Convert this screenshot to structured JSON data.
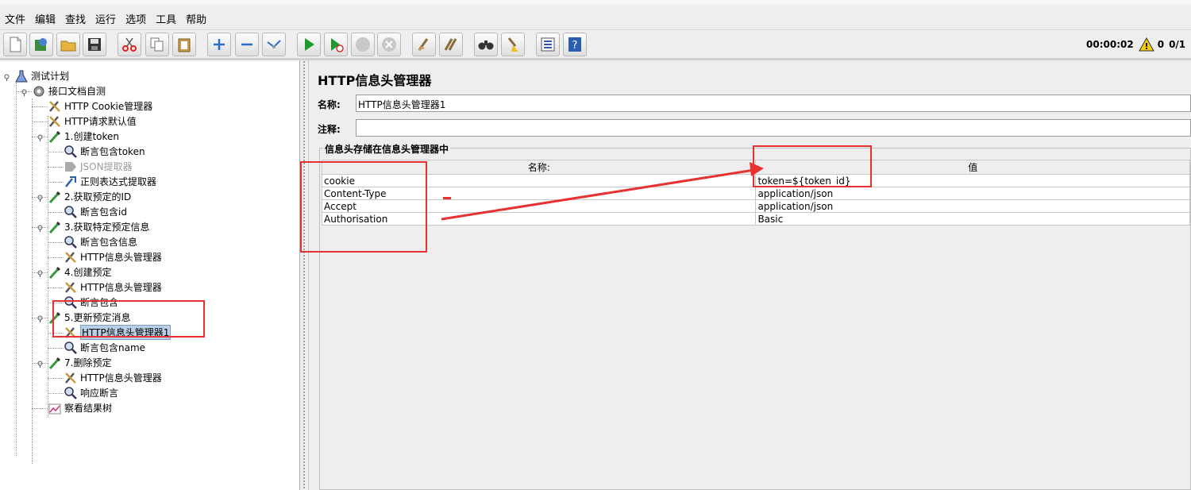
{
  "menu": [
    "文件",
    "编辑",
    "查找",
    "运行",
    "选项",
    "工具",
    "帮助"
  ],
  "toolbar_icons": [
    "new-icon",
    "templates-icon",
    "open-icon",
    "save-icon",
    "cut-icon",
    "copy-icon",
    "paste-icon",
    "expand-icon",
    "collapse-icon",
    "toggle-icon",
    "start-icon",
    "start-no-pause-icon",
    "stop-icon",
    "shutdown-icon",
    "clear-icon",
    "clear-all-icon",
    "search-icon",
    "reset-search-icon",
    "function-helper-icon",
    "help-icon"
  ],
  "status": {
    "timer": "00:00:02",
    "warnings": "0",
    "threads": "0/1"
  },
  "tree": [
    {
      "label": "测试计划",
      "icon": "flask-icon",
      "depth": 0
    },
    {
      "label": "接口文档自测",
      "icon": "gear-icon",
      "depth": 1
    },
    {
      "label": "HTTP Cookie管理器",
      "icon": "tools-icon",
      "depth": 2
    },
    {
      "label": "HTTP请求默认值",
      "icon": "tools-icon",
      "depth": 2
    },
    {
      "label": "1.创建token",
      "icon": "pipette-icon",
      "depth": 2
    },
    {
      "label": "断言包含token",
      "icon": "magnifier-icon",
      "depth": 3
    },
    {
      "label": "JSON提取器",
      "icon": "extractor-icon",
      "depth": 3
    },
    {
      "label": "正则表达式提取器",
      "icon": "regex-icon",
      "depth": 3
    },
    {
      "label": "2.获取预定的ID",
      "icon": "pipette-icon",
      "depth": 2
    },
    {
      "label": "断言包含id",
      "icon": "magnifier-icon",
      "depth": 3
    },
    {
      "label": "3.获取特定预定信息",
      "icon": "pipette-icon",
      "depth": 2
    },
    {
      "label": "断言包含信息",
      "icon": "magnifier-icon",
      "depth": 3
    },
    {
      "label": "HTTP信息头管理器",
      "icon": "tools-icon",
      "depth": 3
    },
    {
      "label": "4.创建预定",
      "icon": "pipette-icon",
      "depth": 2
    },
    {
      "label": "HTTP信息头管理器",
      "icon": "tools-icon",
      "depth": 3
    },
    {
      "label": "断言包含",
      "icon": "magnifier-icon",
      "depth": 3
    },
    {
      "label": "5.更新预定消息",
      "icon": "pipette-icon",
      "depth": 2
    },
    {
      "label": "HTTP信息头管理器1",
      "icon": "tools-icon",
      "depth": 3
    },
    {
      "label": "断言包含name",
      "icon": "magnifier-icon",
      "depth": 3
    },
    {
      "label": "7.删除预定",
      "icon": "pipette-icon",
      "depth": 2
    },
    {
      "label": "HTTP信息头管理器",
      "icon": "tools-icon",
      "depth": 3
    },
    {
      "label": "响应断言",
      "icon": "magnifier-icon",
      "depth": 3
    },
    {
      "label": "察看结果树",
      "icon": "graph-icon",
      "depth": 2
    }
  ],
  "panel": {
    "title": "HTTP信息头管理器",
    "name_label": "名称:",
    "name_value": "HTTP信息头管理器1",
    "comment_label": "注释:",
    "comment_value": "",
    "group_title": "信息头存储在信息头管理器中",
    "col_name": "名称:",
    "col_value": "值",
    "rows": [
      {
        "name": "cookie",
        "value": "token=${token_id}"
      },
      {
        "name": "Content-Type",
        "value": "application/json"
      },
      {
        "name": "Accept",
        "value": "application/json"
      },
      {
        "name": "Authorisation",
        "value": "Basic"
      }
    ]
  },
  "annotation_color": "#e83232"
}
